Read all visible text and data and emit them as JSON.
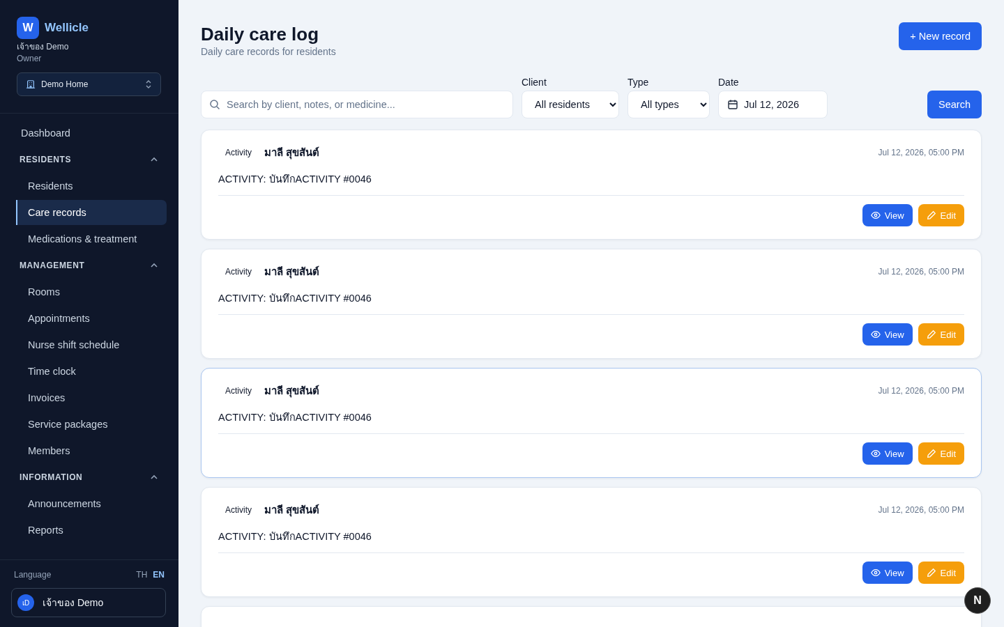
{
  "brand": {
    "logo_letter": "W",
    "name": "Wellicle",
    "user_line": "เจ้าของ Demo",
    "role": "Owner"
  },
  "home_selector": {
    "value": "Demo Home"
  },
  "nav": [
    {
      "kind": "item",
      "label": "Dashboard",
      "selected": false
    },
    {
      "kind": "section",
      "label": "RESIDENTS",
      "expanded": true,
      "children": [
        {
          "label": "Residents",
          "selected": false
        },
        {
          "label": "Care records",
          "selected": true
        },
        {
          "label": "Medications & treatment",
          "selected": false
        }
      ]
    },
    {
      "kind": "section",
      "label": "MANAGEMENT",
      "expanded": true,
      "children": [
        {
          "label": "Rooms",
          "selected": false
        },
        {
          "label": "Appointments",
          "selected": false
        },
        {
          "label": "Nurse shift schedule",
          "selected": false
        },
        {
          "label": "Time clock",
          "selected": false
        },
        {
          "label": "Invoices",
          "selected": false
        },
        {
          "label": "Service packages",
          "selected": false
        },
        {
          "label": "Members",
          "selected": false
        }
      ]
    },
    {
      "kind": "section",
      "label": "INFORMATION",
      "expanded": true,
      "children": [
        {
          "label": "Announcements",
          "selected": false
        },
        {
          "label": "Reports",
          "selected": false
        }
      ]
    }
  ],
  "language": {
    "label": "Language",
    "options": [
      {
        "label": "TH",
        "selected": false
      },
      {
        "label": "EN",
        "selected": true
      }
    ]
  },
  "account": {
    "initials": "เD",
    "name": "เจ้าของ Demo"
  },
  "page": {
    "title": "Daily care log",
    "subtitle": "Daily care records for residents",
    "new_button": "+ New record"
  },
  "filters": {
    "search_placeholder": "Search by client, notes, or medicine...",
    "client": {
      "label": "Client",
      "value": "All residents"
    },
    "type": {
      "label": "Type",
      "value": "All types"
    },
    "date": {
      "label": "Date",
      "value": "Jul 12, 2026"
    },
    "search_button": "Search"
  },
  "records": [
    {
      "type": "Activity",
      "client": "มาลี สุขสันต์",
      "datetime": "Jul 12, 2026, 05:00 PM",
      "note": "ACTIVITY: บันทึกACTIVITY #0046",
      "highlighted": false,
      "actions": [
        {
          "kind": "view",
          "label": "View"
        },
        {
          "kind": "edit",
          "label": "Edit"
        }
      ]
    },
    {
      "type": "Activity",
      "client": "มาลี สุขสันต์",
      "datetime": "Jul 12, 2026, 05:00 PM",
      "note": "ACTIVITY: บันทึกACTIVITY #0046",
      "highlighted": false,
      "actions": [
        {
          "kind": "view",
          "label": "View"
        },
        {
          "kind": "edit",
          "label": "Edit"
        }
      ]
    },
    {
      "type": "Activity",
      "client": "มาลี สุขสันต์",
      "datetime": "Jul 12, 2026, 05:00 PM",
      "note": "ACTIVITY: บันทึกACTIVITY #0046",
      "highlighted": true,
      "actions": [
        {
          "kind": "view",
          "label": "View"
        },
        {
          "kind": "edit",
          "label": "Edit"
        }
      ]
    },
    {
      "type": "Activity",
      "client": "มาลี สุขสันต์",
      "datetime": "Jul 12, 2026, 05:00 PM",
      "note": "ACTIVITY: บันทึกACTIVITY #0046",
      "highlighted": false,
      "actions": [
        {
          "kind": "view",
          "label": "View"
        },
        {
          "kind": "edit",
          "label": "Edit"
        }
      ]
    }
  ],
  "floating_badge": {
    "letter": "N"
  }
}
